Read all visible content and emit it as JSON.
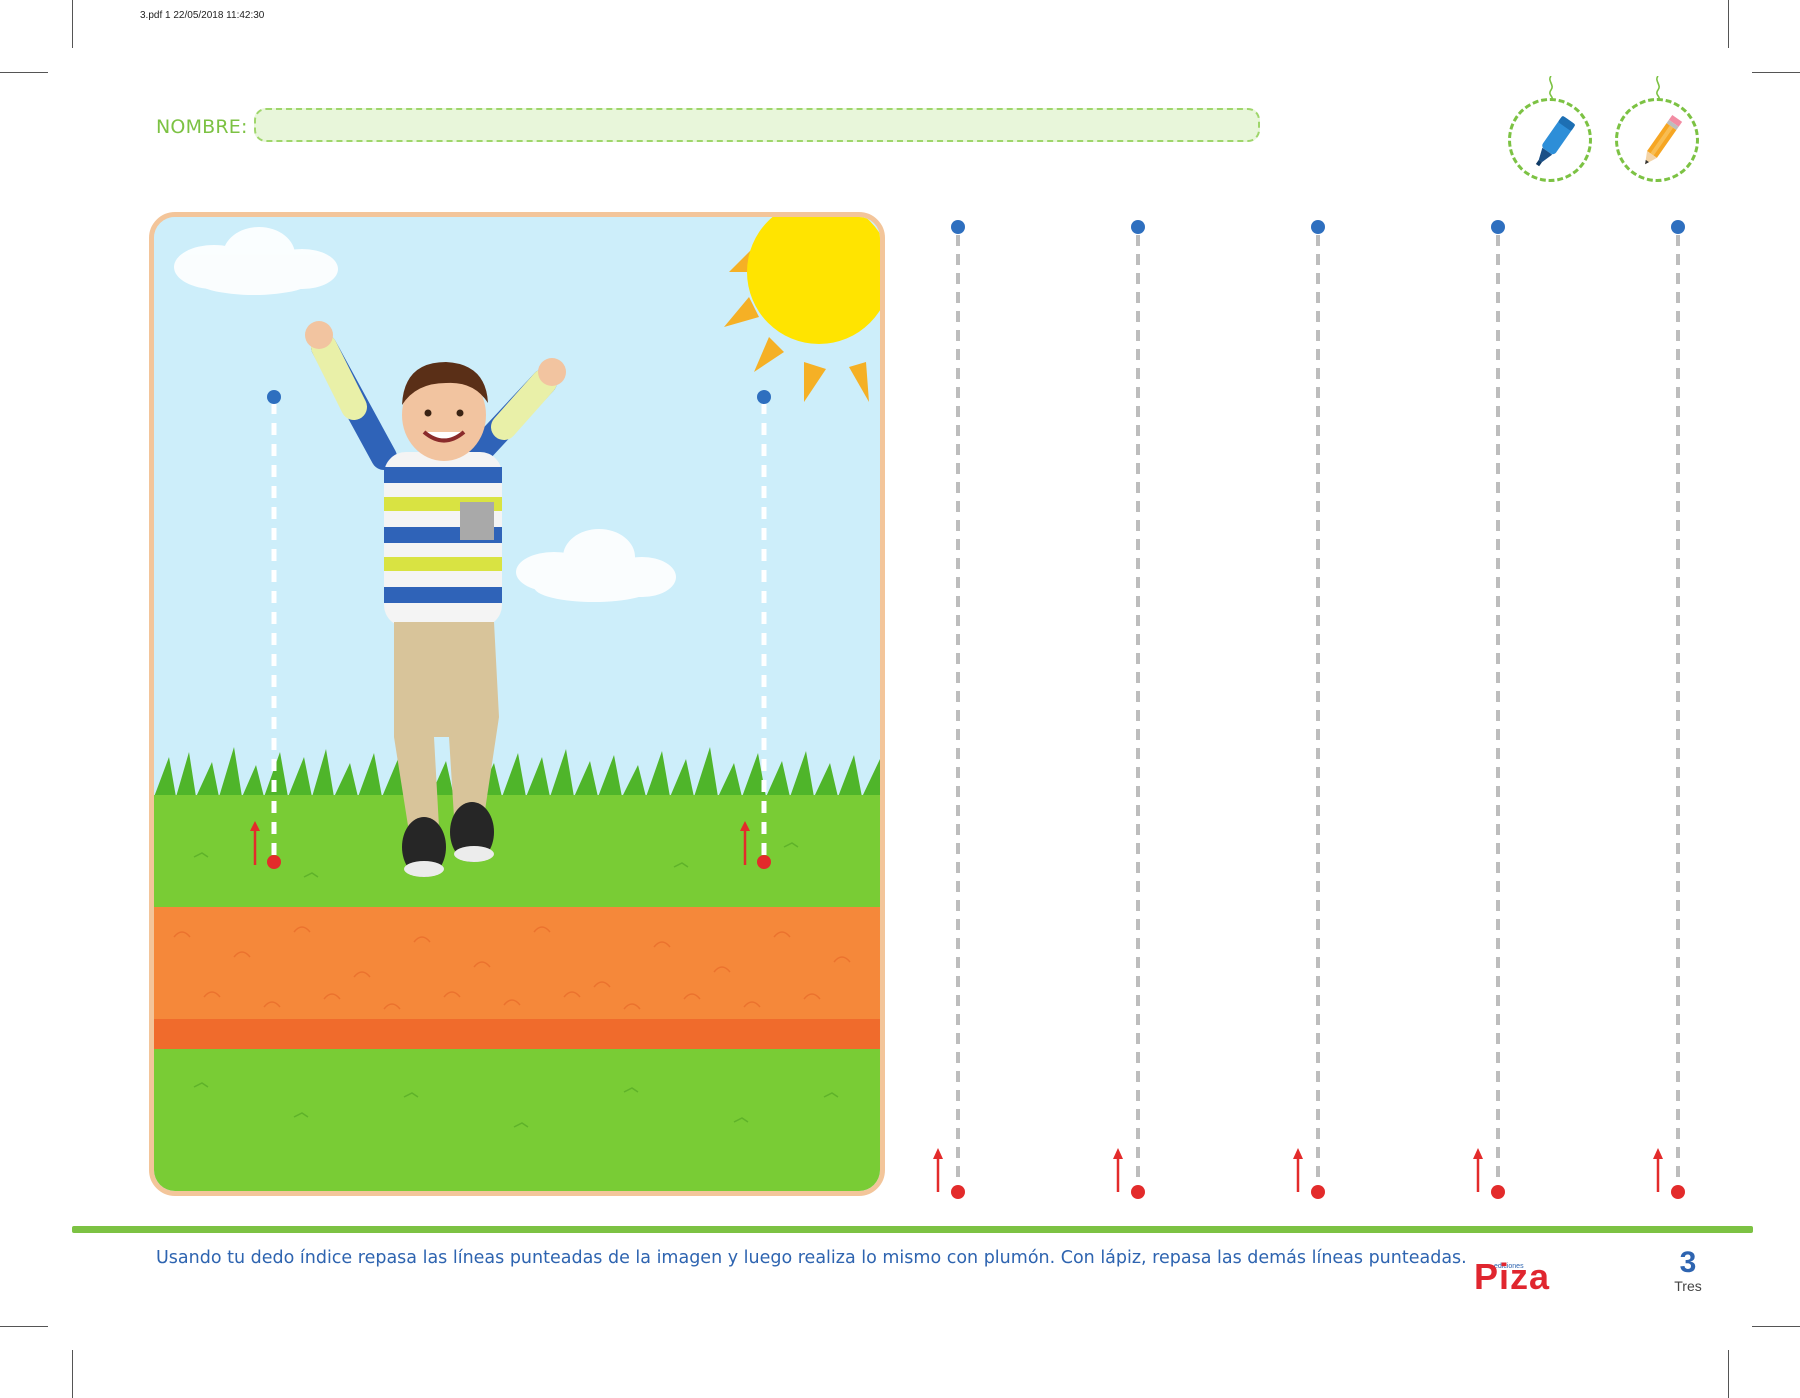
{
  "print_header": "3.pdf   1   22/05/2018   11:42:30",
  "header": {
    "name_label": "NOMBRE:",
    "tools": [
      {
        "icon": "marker-icon",
        "color": "#2d8ed8"
      },
      {
        "icon": "pencil-icon",
        "color": "#f6a623"
      }
    ]
  },
  "tracing": {
    "start_dot_color": "#2e6fbf",
    "end_dot_color": "#e32b2b",
    "dash_color": "#bdbdbd",
    "line_count": 5
  },
  "scene": {
    "sky_color": "#cdeefa",
    "grass_color": "#79cc35",
    "soil_color": "#f5883a",
    "sun_color": "#ffe400"
  },
  "footer": {
    "instruction": "Usando tu dedo índice repasa las líneas punteadas de la imagen y luego realiza lo mismo con plumón. Con lápiz, repasa las demás líneas punteadas.",
    "logo_small": "ediciones",
    "logo": "Piza",
    "page_number": "3",
    "page_word": "Tres"
  }
}
